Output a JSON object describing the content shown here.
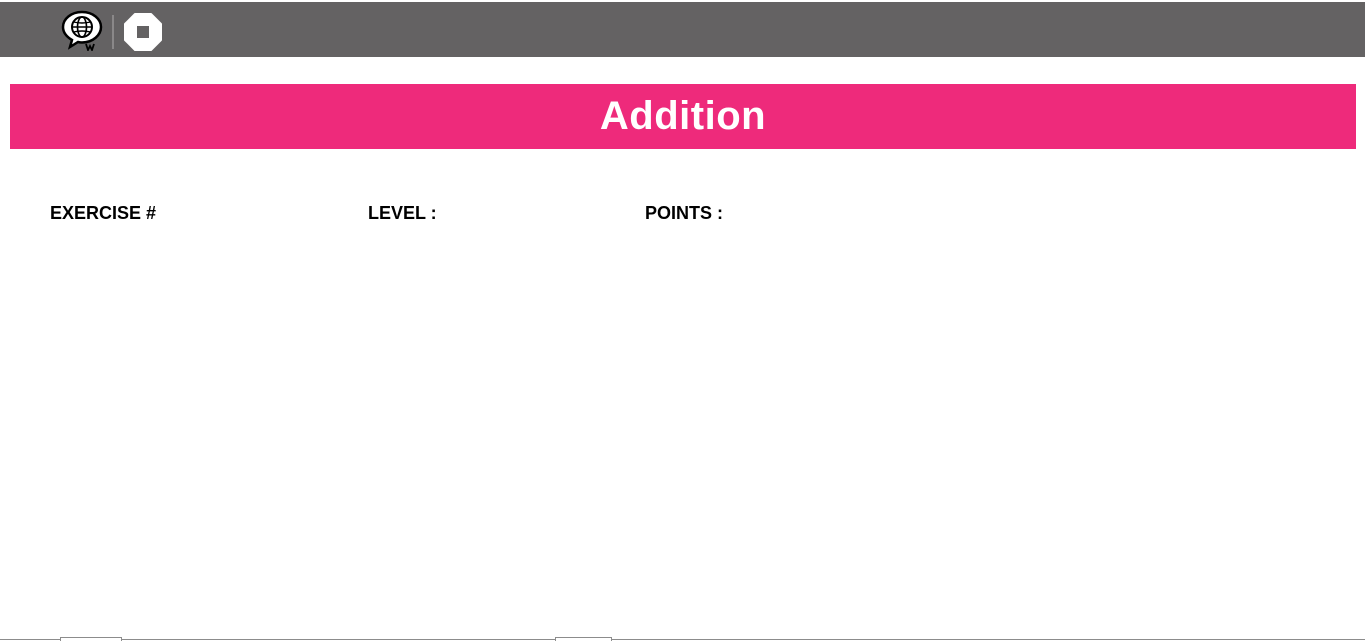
{
  "toolbar": {
    "background": "#646263",
    "translate_icon": "globe-speech-bubble-icon",
    "stop_icon": "stop-octagon-icon"
  },
  "banner": {
    "title": "Addition",
    "background": "#ee2a7b",
    "text_color": "#ffffff"
  },
  "stats": {
    "exercise_label": "EXERCISE #",
    "level_label": "LEVEL :",
    "points_label": "POINTS :"
  }
}
